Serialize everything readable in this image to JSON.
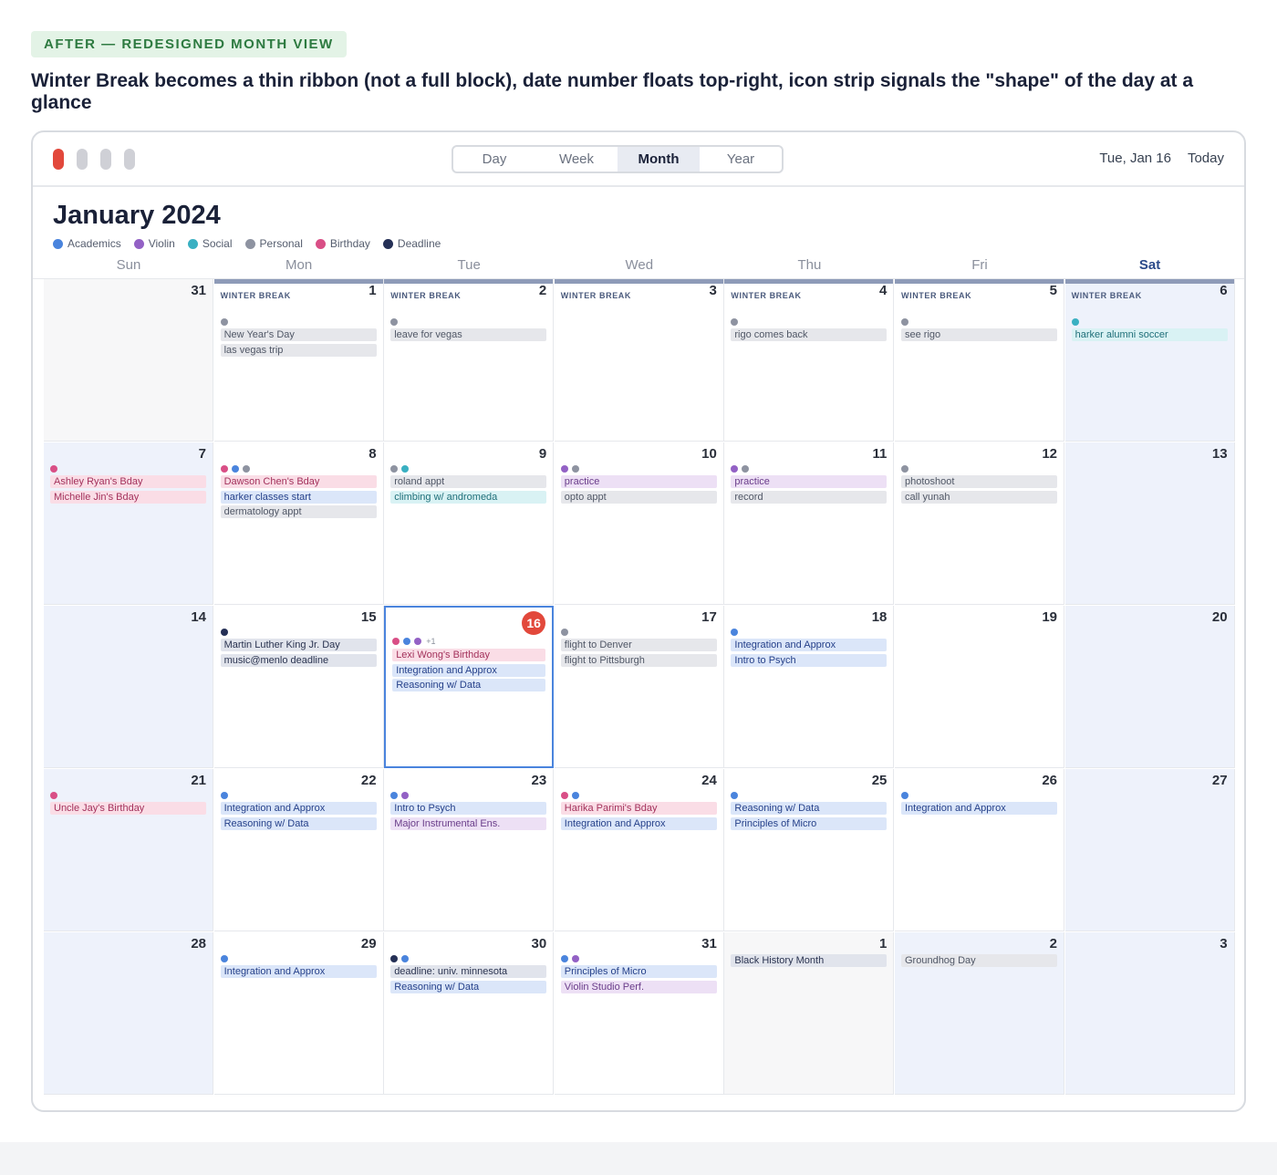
{
  "badge": "AFTER — REDESIGNED MONTH VIEW",
  "headline": "Winter Break becomes a thin ribbon (not a full block), date number floats top-right, icon strip signals the \"shape\" of the day at a glance",
  "toolbar": {
    "views": [
      "Day",
      "Week",
      "Month",
      "Year"
    ],
    "active_view": "Month",
    "current_date": "Tue, Jan 16",
    "today_label": "Today"
  },
  "month_title": "January 2024",
  "colors": {
    "academics": "#4a84dd",
    "violin": "#9361c5",
    "social": "#3ab0c2",
    "personal": "#8e93a1",
    "birthday": "#d94f86",
    "deadline": "#253056",
    "today_red": "#e2483b",
    "ribbon": "#8e9bb8"
  },
  "legend": [
    {
      "label": "Academics",
      "cat": "academics"
    },
    {
      "label": "Violin",
      "cat": "violin"
    },
    {
      "label": "Social",
      "cat": "social"
    },
    {
      "label": "Personal",
      "cat": "personal"
    },
    {
      "label": "Birthday",
      "cat": "birthday"
    },
    {
      "label": "Deadline",
      "cat": "deadline"
    }
  ],
  "weekdays": [
    "Sun",
    "Mon",
    "Tue",
    "Wed",
    "Thu",
    "Fri",
    "Sat"
  ],
  "ribbon_label": "WINTER BREAK",
  "weeks": [
    [
      {
        "day": "31",
        "style": "other",
        "dots": [],
        "events": []
      },
      {
        "day": "1",
        "ribbon": true,
        "dots": [
          "personal"
        ],
        "events": [
          {
            "t": "New Year's Day",
            "c": "personal"
          },
          {
            "t": "las vegas trip",
            "c": "personal"
          }
        ]
      },
      {
        "day": "2",
        "ribbon": true,
        "dots": [
          "personal"
        ],
        "events": [
          {
            "t": "leave for vegas",
            "c": "personal"
          }
        ]
      },
      {
        "day": "3",
        "ribbon": true,
        "dots": [],
        "events": []
      },
      {
        "day": "4",
        "ribbon": true,
        "dots": [
          "personal"
        ],
        "events": [
          {
            "t": "rigo comes back",
            "c": "personal"
          }
        ]
      },
      {
        "day": "5",
        "ribbon": true,
        "dots": [
          "personal"
        ],
        "events": [
          {
            "t": "see rigo",
            "c": "personal"
          }
        ]
      },
      {
        "day": "6",
        "ribbon": true,
        "style": "weekend",
        "dots": [
          "social"
        ],
        "events": [
          {
            "t": "harker alumni soccer",
            "c": "social"
          }
        ]
      }
    ],
    [
      {
        "day": "7",
        "style": "weekend",
        "dots": [
          "birthday"
        ],
        "events": [
          {
            "t": "Ashley Ryan's Bday",
            "c": "birthday"
          },
          {
            "t": "Michelle Jin's Bday",
            "c": "birthday"
          }
        ]
      },
      {
        "day": "8",
        "dots": [
          "birthday",
          "academics",
          "personal"
        ],
        "events": [
          {
            "t": "Dawson Chen's Bday",
            "c": "birthday"
          },
          {
            "t": "harker classes start",
            "c": "academics"
          },
          {
            "t": "dermatology appt",
            "c": "personal"
          }
        ]
      },
      {
        "day": "9",
        "dots": [
          "personal",
          "social"
        ],
        "events": [
          {
            "t": "roland appt",
            "c": "personal"
          },
          {
            "t": "climbing w/ andromeda",
            "c": "social"
          }
        ]
      },
      {
        "day": "10",
        "dots": [
          "violin",
          "personal"
        ],
        "events": [
          {
            "t": "practice",
            "c": "violin"
          },
          {
            "t": "opto appt",
            "c": "personal"
          }
        ]
      },
      {
        "day": "11",
        "dots": [
          "violin",
          "personal"
        ],
        "events": [
          {
            "t": "practice",
            "c": "violin"
          },
          {
            "t": "record",
            "c": "personal"
          }
        ]
      },
      {
        "day": "12",
        "dots": [
          "personal"
        ],
        "events": [
          {
            "t": "photoshoot",
            "c": "personal"
          },
          {
            "t": "call yunah",
            "c": "personal"
          }
        ]
      },
      {
        "day": "13",
        "style": "weekend",
        "dots": [],
        "events": []
      }
    ],
    [
      {
        "day": "14",
        "style": "weekend",
        "dots": [],
        "events": []
      },
      {
        "day": "15",
        "dots": [
          "deadline"
        ],
        "events": [
          {
            "t": "Martin Luther King Jr. Day",
            "c": "deadline"
          },
          {
            "t": "music@menlo deadline",
            "c": "deadline"
          }
        ]
      },
      {
        "day": "16",
        "today": true,
        "dots": [
          "birthday",
          "academics",
          "violin"
        ],
        "more": "+1",
        "events": [
          {
            "t": "Lexi Wong's Birthday",
            "c": "birthday"
          },
          {
            "t": "Integration and Approx",
            "c": "academics"
          },
          {
            "t": "Reasoning w/ Data",
            "c": "academics"
          }
        ]
      },
      {
        "day": "17",
        "dots": [
          "personal"
        ],
        "events": [
          {
            "t": "flight to Denver",
            "c": "personal"
          },
          {
            "t": "flight to Pittsburgh",
            "c": "personal"
          }
        ]
      },
      {
        "day": "18",
        "dots": [
          "academics"
        ],
        "events": [
          {
            "t": "Integration and Approx",
            "c": "academics"
          },
          {
            "t": "Intro to Psych",
            "c": "academics"
          }
        ]
      },
      {
        "day": "19",
        "dots": [],
        "events": []
      },
      {
        "day": "20",
        "style": "weekend",
        "dots": [],
        "events": []
      }
    ],
    [
      {
        "day": "21",
        "style": "weekend",
        "dots": [
          "birthday"
        ],
        "events": [
          {
            "t": "Uncle Jay's Birthday",
            "c": "birthday"
          }
        ]
      },
      {
        "day": "22",
        "dots": [
          "academics"
        ],
        "events": [
          {
            "t": "Integration and Approx",
            "c": "academics"
          },
          {
            "t": "Reasoning w/ Data",
            "c": "academics"
          }
        ]
      },
      {
        "day": "23",
        "dots": [
          "academics",
          "violin"
        ],
        "events": [
          {
            "t": "Intro to Psych",
            "c": "academics"
          },
          {
            "t": "Major Instrumental Ens.",
            "c": "violin"
          }
        ]
      },
      {
        "day": "24",
        "dots": [
          "birthday",
          "academics"
        ],
        "events": [
          {
            "t": "Harika Parimi's Bday",
            "c": "birthday"
          },
          {
            "t": "Integration and Approx",
            "c": "academics"
          }
        ]
      },
      {
        "day": "25",
        "dots": [
          "academics"
        ],
        "events": [
          {
            "t": "Reasoning w/ Data",
            "c": "academics"
          },
          {
            "t": "Principles of Micro",
            "c": "academics"
          }
        ]
      },
      {
        "day": "26",
        "dots": [
          "academics"
        ],
        "events": [
          {
            "t": "Integration and Approx",
            "c": "academics"
          }
        ]
      },
      {
        "day": "27",
        "style": "weekend",
        "dots": [],
        "events": []
      }
    ],
    [
      {
        "day": "28",
        "style": "weekend",
        "dots": [],
        "events": []
      },
      {
        "day": "29",
        "dots": [
          "academics"
        ],
        "events": [
          {
            "t": "Integration and Approx",
            "c": "academics"
          }
        ]
      },
      {
        "day": "30",
        "dots": [
          "deadline",
          "academics"
        ],
        "events": [
          {
            "t": "deadline: univ. minnesota",
            "c": "deadline"
          },
          {
            "t": "Reasoning w/ Data",
            "c": "academics"
          }
        ]
      },
      {
        "day": "31",
        "dots": [
          "academics",
          "violin"
        ],
        "events": [
          {
            "t": "Principles of Micro",
            "c": "academics"
          },
          {
            "t": "Violin Studio Perf.",
            "c": "violin"
          }
        ]
      },
      {
        "day": "1",
        "style": "other",
        "dots": [],
        "events": [
          {
            "t": "Black History Month",
            "c": "deadline"
          }
        ]
      },
      {
        "day": "2",
        "style": "weekend",
        "dots": [],
        "events": [
          {
            "t": "Groundhog Day",
            "c": "personal"
          }
        ]
      },
      {
        "day": "3",
        "style": "weekend",
        "dots": [],
        "events": []
      }
    ]
  ]
}
